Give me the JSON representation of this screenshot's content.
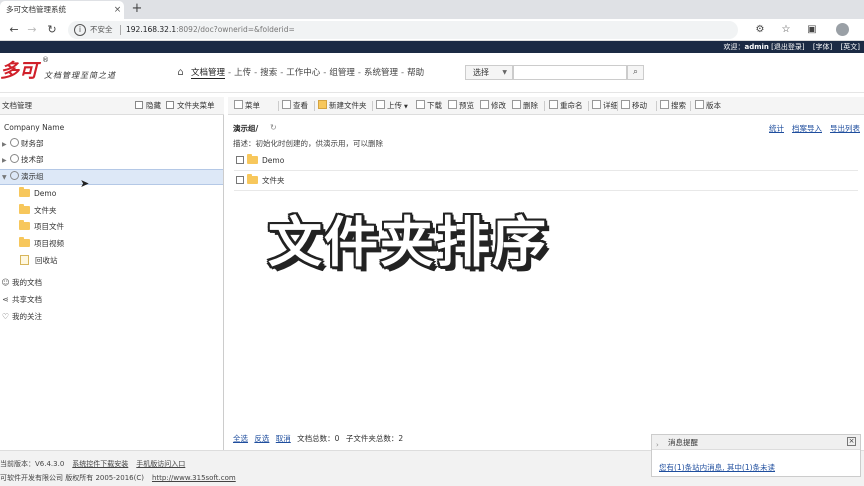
{
  "browser": {
    "tab_title": "多可文档管理系统",
    "tab_close": "×",
    "new_tab": "+",
    "back": "←",
    "forward": "→",
    "reload": "↻",
    "security_icon": "i",
    "security_text": "不安全",
    "url_host": "192.168.32.1",
    "url_rest": ":8092/doc?ownerid=&folderid="
  },
  "userstrip": {
    "welcome": "欢迎：",
    "username": "admin",
    "logout": "[退出登录]",
    "font": "[字体]",
    "lang": "[英文]"
  },
  "header": {
    "logo": "多可",
    "logo_reg": "®",
    "slogan": "文档管理至简之道",
    "nav": [
      "文档管理",
      "上传",
      "搜索",
      "工作中心",
      "组管理",
      "系统管理",
      "帮助"
    ],
    "nav_sep": "-",
    "search_select": "选择",
    "search_value": ""
  },
  "left": {
    "title": "文档管理",
    "hide": "隐藏",
    "folder_menu": "文件夹菜单",
    "tree": {
      "company": "Company Name",
      "groups": [
        "财务部",
        "技术部",
        "演示组"
      ],
      "folders": [
        "Demo",
        "文件夹",
        "项目文件",
        "项目视频"
      ],
      "recycle": "回收站",
      "my_docs": "我的文档",
      "shared_docs": "共享文档",
      "my_follow": "我的关注"
    }
  },
  "toolbar": {
    "items": [
      "菜单",
      "查看",
      "新建文件夹",
      "上传",
      "下载",
      "预览",
      "修改",
      "删除",
      "重命名",
      "详细",
      "移动",
      "搜索",
      "版本"
    ]
  },
  "content": {
    "breadcrumb": "演示组/",
    "description": "描述：初始化时创建的，供演示用，可以删除",
    "links": [
      "统计",
      "档案导入",
      "导出列表"
    ],
    "rows": [
      "Demo",
      "文件夹"
    ],
    "bottom": {
      "select_all": "全选",
      "invert": "反选",
      "cancel": "取消",
      "doc_total": "文档总数：0",
      "sub_total": "子文件夹总数：2"
    }
  },
  "overlay_title": "文件夹排序",
  "footer": {
    "version": "当前版本：V6.4.3.0",
    "download": "系统控件下载安装",
    "mobile": "手机版访问入口",
    "copyright": "可软件开发有限公司 版权所有 2005-2016(C)",
    "site": "http://www.315soft.com"
  },
  "notify": {
    "title": "消息提醒",
    "body": "您有(1)条站内消息, 其中(1)条未读"
  }
}
